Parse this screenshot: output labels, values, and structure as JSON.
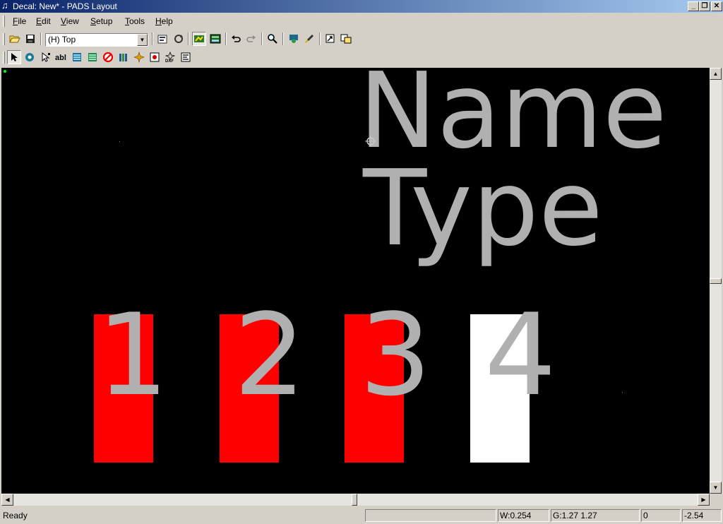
{
  "window": {
    "title": "Decal: New* - PADS Layout",
    "buttons": {
      "minimize": "_",
      "restore": "❐",
      "close": "✕"
    }
  },
  "menu": [
    {
      "label": "File"
    },
    {
      "label": "Edit"
    },
    {
      "label": "View"
    },
    {
      "label": "Setup"
    },
    {
      "label": "Tools"
    },
    {
      "label": "Help"
    }
  ],
  "toolbar1": {
    "layer_select_value": "(H) Top",
    "icons": [
      "open-icon",
      "save-icon",
      "layer-combo",
      "properties-icon",
      "redraw-icon",
      "display-control-icon",
      "sheet-icon",
      "undo-icon",
      "redo-icon",
      "zoom-icon",
      "view-icon",
      "brush-icon",
      "move-icon",
      "window-icon"
    ]
  },
  "toolbar2": {
    "icons": [
      "select-icon",
      "pad-icon",
      "terminal-icon",
      "text-icon",
      "2d-line-icon",
      "copper-icon",
      "keepout-icon",
      "pin-icon",
      "wizard-icon",
      "decal-icon",
      "dxf-icon",
      "report-icon"
    ]
  },
  "canvas": {
    "background": "#000000",
    "name_label": "Name",
    "type_label": "Type",
    "pad_numbers": [
      "1",
      "2",
      "3",
      "4"
    ],
    "pad_colors": [
      "#ff0000",
      "#ff0000",
      "#ff0000",
      "#ffffff"
    ],
    "text_color": "#b0b0b0"
  },
  "status": {
    "ready": "Ready",
    "width": "W:0.254",
    "grid": "G:1.27 1.27",
    "x": "0",
    "y": "-2.54"
  }
}
